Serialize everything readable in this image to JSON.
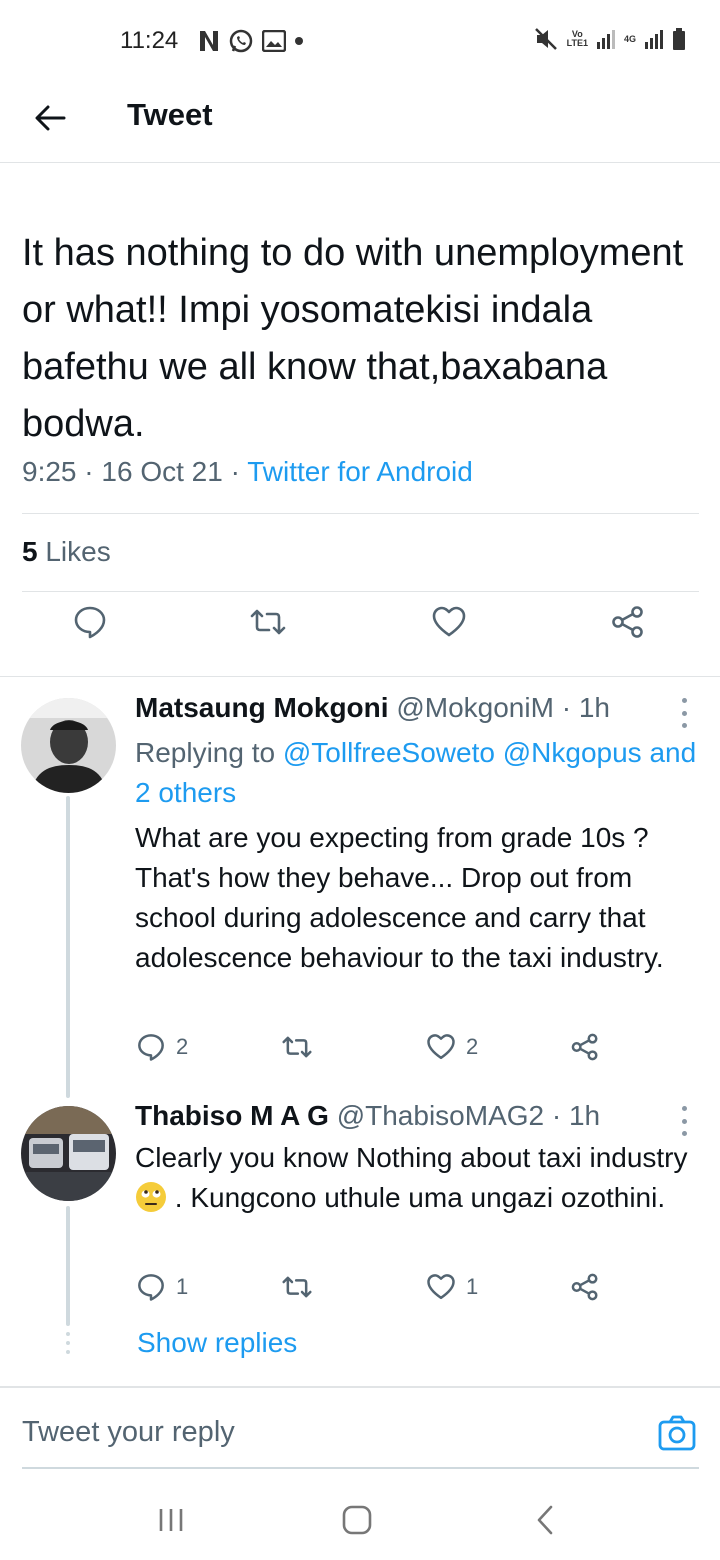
{
  "status_bar": {
    "time": "11:24",
    "network_label_top": "Vo",
    "network_label_bottom": "LTE1",
    "network_4g": "4G"
  },
  "header": {
    "title": "Tweet"
  },
  "tweet": {
    "text": "It has nothing to do with unemployment or what!! Impi yosomatekisi indala bafethu we all know that,baxabana bodwa.",
    "time": "9:25",
    "date": "16 Oct 21",
    "source": "Twitter for Android",
    "likes_count": "5",
    "likes_label": "Likes"
  },
  "replies": [
    {
      "name": "Matsaung Mokgoni",
      "handle": "@MokgoniM",
      "age": "1h",
      "replying_prefix": "Replying to",
      "replying_mentions": "@TollfreeSoweto @Nkgopus",
      "replying_others": "and 2 others",
      "text": "What are you expecting from grade 10s ? That's how they behave... Drop out from school during adolescence and carry that adolescence behaviour to the taxi industry.",
      "reply_count": "2",
      "like_count": "2"
    },
    {
      "name": "Thabiso M A G",
      "handle": "@ThabisoMAG2",
      "age": "1h",
      "text_before_emoji": "Clearly you know Nothing about taxi industry",
      "text_after_emoji": ".  Kungcono uthule uma ungazi ozothini.",
      "reply_count": "1",
      "like_count": "1"
    }
  ],
  "show_replies": "Show replies",
  "composer": {
    "placeholder": "Tweet your reply"
  },
  "colors": {
    "accent": "#1d9bf0",
    "text": "#0f1419",
    "secondary": "#536471",
    "divider": "#e1e4e6"
  },
  "icons": [
    "back-arrow-icon",
    "reply-icon",
    "retweet-icon",
    "like-icon",
    "share-icon",
    "more-icon",
    "camera-icon"
  ]
}
